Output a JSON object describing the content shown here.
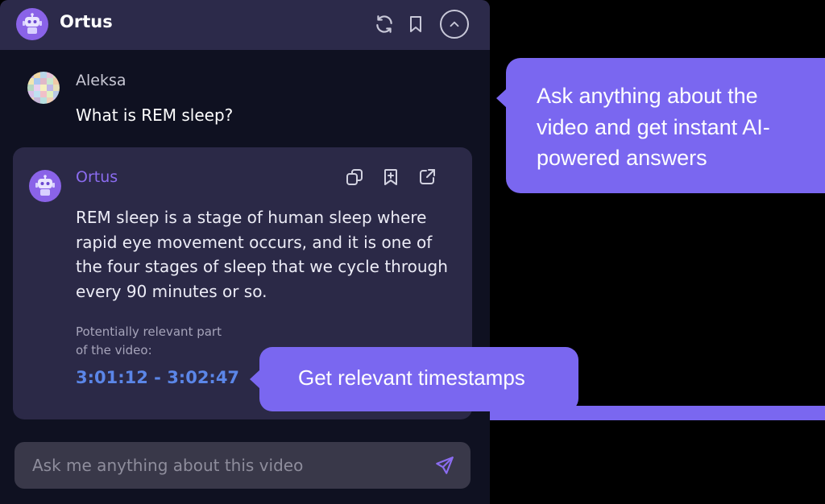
{
  "header": {
    "title": "Ortus",
    "icons": [
      "robot-icon",
      "refresh-icon",
      "bookmark-icon",
      "chevron-up-icon"
    ]
  },
  "user_message": {
    "name": "Aleksa",
    "text": "What is REM sleep?"
  },
  "bot_reply": {
    "name": "Ortus",
    "text": "REM sleep is a stage of human sleep where rapid eye movement occurs, and it is one of the four stages of sleep that we cycle through every 90 minutes or so.",
    "relevant_label": "Potentially relevant part of the video:",
    "timestamp": "3:01:12 - 3:02:47",
    "action_icons": [
      "copy-icon",
      "bookmark-add-icon",
      "share-icon"
    ]
  },
  "input": {
    "placeholder": "Ask me anything about this video",
    "value": ""
  },
  "callouts": {
    "ask": "Ask anything about the video and get instant AI-powered answers",
    "timestamps": "Get relevant timestamps"
  },
  "colors": {
    "panel_bg": "#0f1121",
    "header_bg": "#2c2a4a",
    "card_bg": "#2b2947",
    "accent": "#7a67f0",
    "bot_name": "#8b6cf0",
    "timestamp": "#5b86e8"
  }
}
